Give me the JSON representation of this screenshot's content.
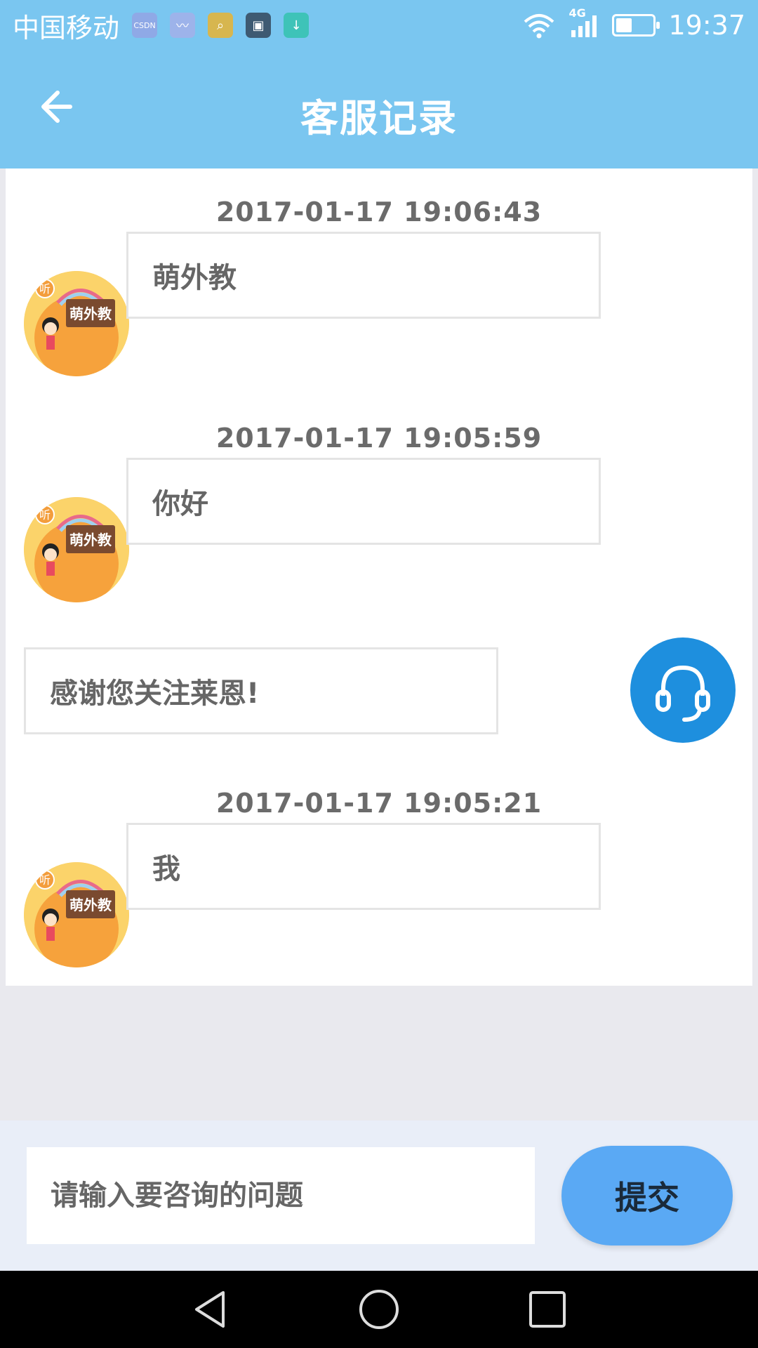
{
  "status_bar": {
    "carrier": "中国移动",
    "notif_icons": [
      {
        "name": "csdn-app-icon",
        "color": "#8fa9e6",
        "glyph": "CSDN"
      },
      {
        "name": "health-app-icon",
        "color": "#9db3ea",
        "glyph": "〰"
      },
      {
        "name": "search-app-icon",
        "color": "#d7b64f",
        "glyph": "⌕"
      },
      {
        "name": "gallery-app-icon",
        "color": "#3e5a72",
        "glyph": "▣"
      },
      {
        "name": "download-app-icon",
        "color": "#3ec3b8",
        "glyph": "↓"
      }
    ],
    "network": "4G",
    "time": "19:37"
  },
  "header": {
    "title": "客服记录"
  },
  "conversation": [
    {
      "timestamp": "2017-01-17  19:06:43",
      "user_message": "萌外教"
    },
    {
      "timestamp": "2017-01-17  19:05:59",
      "user_message": "你好",
      "agent_reply": "感谢您关注莱恩!"
    },
    {
      "timestamp": "2017-01-17  19:05:21",
      "user_message": "我"
    }
  ],
  "avatar_text": {
    "badge": "听",
    "sign": "萌外教"
  },
  "input": {
    "placeholder": "请输入要咨询的问题",
    "submit_label": "提交"
  },
  "colors": {
    "primary": "#7ac6f0",
    "agent": "#1e8fde",
    "submit": "#5aa9f4"
  }
}
